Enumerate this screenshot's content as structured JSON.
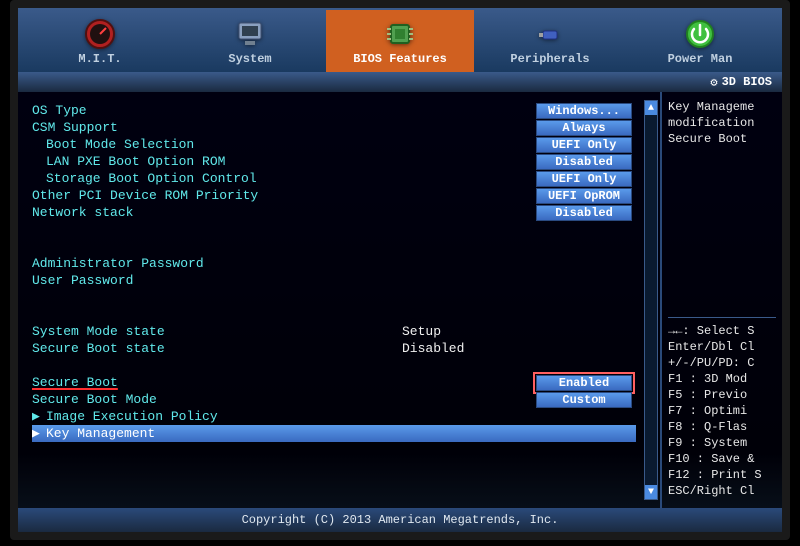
{
  "tabs": {
    "items": [
      {
        "label": "M.I.T."
      },
      {
        "label": "System"
      },
      {
        "label": "BIOS Features"
      },
      {
        "label": "Peripherals"
      },
      {
        "label": "Power Man"
      }
    ],
    "active_index": 2
  },
  "brand": "3D BIOS",
  "settings": [
    {
      "label": "OS Type",
      "value": "Windows...",
      "indent": 0
    },
    {
      "label": "CSM Support",
      "value": "Always",
      "indent": 0
    },
    {
      "label": "Boot Mode Selection",
      "value": "UEFI Only",
      "indent": 1
    },
    {
      "label": "LAN PXE Boot Option ROM",
      "value": "Disabled",
      "indent": 1
    },
    {
      "label": "Storage Boot Option Control",
      "value": "UEFI Only",
      "indent": 1
    },
    {
      "label": "Other PCI Device ROM Priority",
      "value": "UEFI OpROM",
      "indent": 0
    },
    {
      "label": "Network stack",
      "value": "Disabled",
      "indent": 0
    }
  ],
  "passwords": [
    {
      "label": "Administrator Password"
    },
    {
      "label": "User Password"
    }
  ],
  "states": [
    {
      "label": "System Mode state",
      "value": "Setup"
    },
    {
      "label": "Secure Boot state",
      "value": "Disabled"
    }
  ],
  "secure_boot": {
    "header": "Secure Boot",
    "enabled_value": "Enabled",
    "mode_label": "Secure Boot Mode",
    "mode_value": "Custom"
  },
  "submenus": [
    {
      "label": "Image Execution Policy"
    },
    {
      "label": "Key Management"
    }
  ],
  "help": {
    "top": [
      "Key Manageme",
      "modification",
      "Secure Boot"
    ],
    "bottom": [
      "→←: Select S",
      "Enter/Dbl Cl",
      "+/-/PU/PD: C",
      "F1  : 3D Mod",
      "F5  : Previo",
      "F7  : Optimi",
      "F8  : Q-Flas",
      "F9  : System",
      "F10 : Save &",
      "F12 : Print S",
      "ESC/Right Cl"
    ]
  },
  "footer": "Copyright (C) 2013 American Megatrends, Inc."
}
